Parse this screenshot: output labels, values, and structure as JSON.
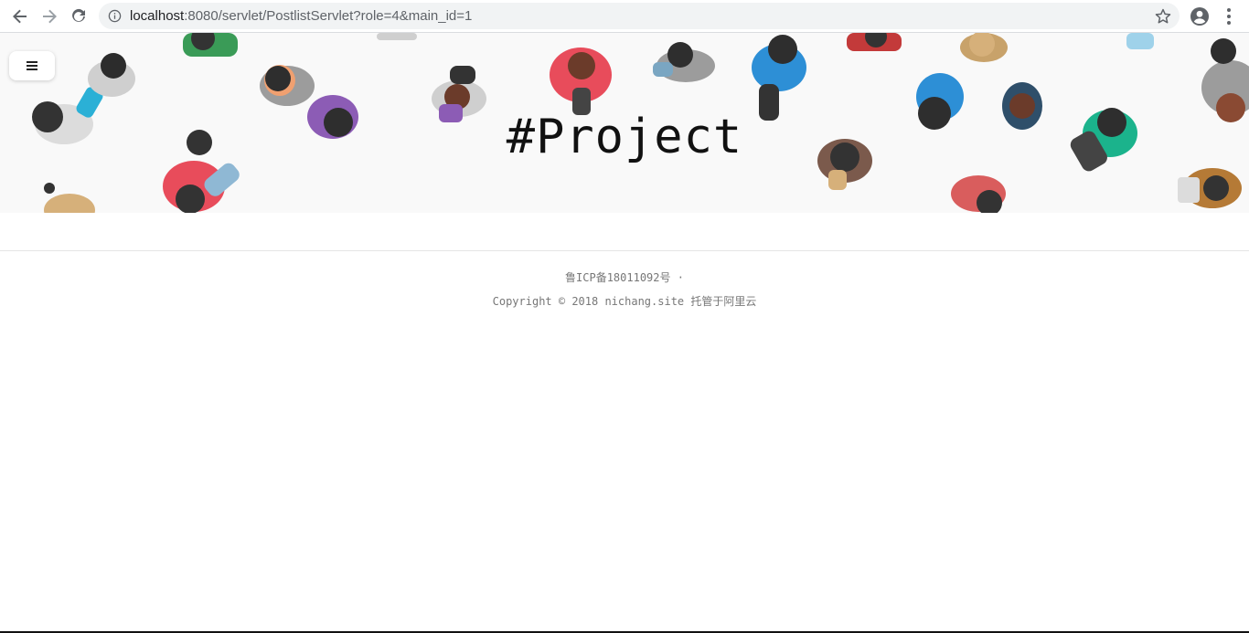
{
  "browser": {
    "url_host": "localhost",
    "url_rest": ":8080/servlet/PostlistServlet?role=4&main_id=1",
    "icons": {
      "back": "arrow-left-icon",
      "forward": "arrow-right-icon",
      "reload": "reload-icon",
      "info": "info-icon",
      "star": "star-icon",
      "profile": "account-circle-icon",
      "menu": "more-vert-icon"
    }
  },
  "hero": {
    "title": "#Project",
    "menu_icon": "hamburger-icon"
  },
  "footer": {
    "icp": "鲁ICP备18011092号 ·",
    "copyright": "Copyright © 2018 nichang.site 托管于阿里云"
  },
  "colors": {
    "hero_bg": "#f9f9f9",
    "footer_text": "#777777",
    "omnibox_bg": "#f1f3f4"
  }
}
